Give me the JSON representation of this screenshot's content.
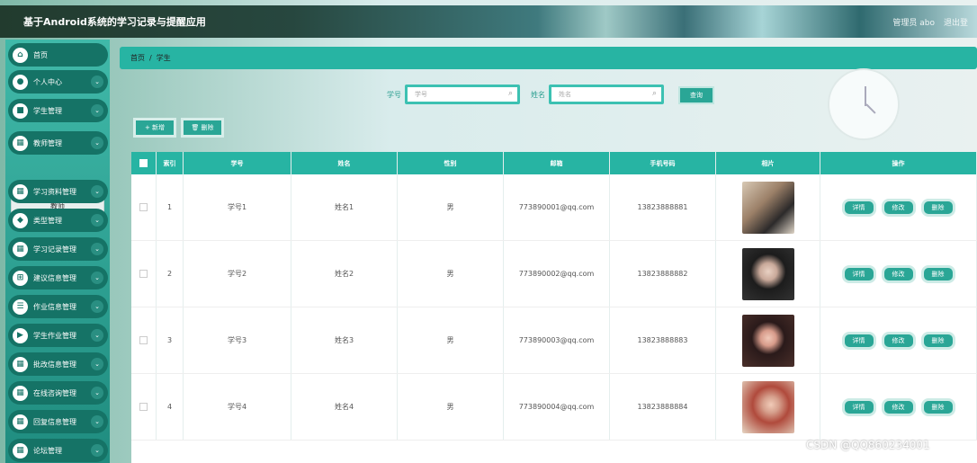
{
  "header": {
    "title": "基于Android系统的学习记录与提醒应用",
    "user": "管理员 abo",
    "logout": "退出登"
  },
  "sidebar": {
    "items": [
      {
        "label": "首页",
        "icon": "home-icon",
        "glyph": "⌂",
        "chev": false
      },
      {
        "label": "个人中心",
        "icon": "user-icon",
        "glyph": "●",
        "chev": true
      },
      {
        "label": "学生管理",
        "icon": "student-icon",
        "glyph": "■",
        "chev": true
      },
      {
        "label": "教师管理",
        "icon": "teacher-icon",
        "glyph": "▦",
        "chev": true
      },
      {
        "label": "学习资料管理",
        "icon": "material-icon",
        "glyph": "▦",
        "chev": true
      },
      {
        "label": "类型管理",
        "icon": "type-icon",
        "glyph": "◆",
        "chev": true
      },
      {
        "label": "学习记录管理",
        "icon": "record-icon",
        "glyph": "▦",
        "chev": true
      },
      {
        "label": "建议信息管理",
        "icon": "suggest-icon",
        "glyph": "⊞",
        "chev": true
      },
      {
        "label": "作业信息管理",
        "icon": "homework-icon",
        "glyph": "☰",
        "chev": true
      },
      {
        "label": "学生作业管理",
        "icon": "video-icon",
        "glyph": "▶",
        "chev": true
      },
      {
        "label": "批改信息管理",
        "icon": "correct-icon",
        "glyph": "▦",
        "chev": true
      },
      {
        "label": "在线咨询管理",
        "icon": "consult-icon",
        "glyph": "▦",
        "chev": true
      },
      {
        "label": "回复信息管理",
        "icon": "reply-icon",
        "glyph": "▦",
        "chev": true
      },
      {
        "label": "论坛管理",
        "icon": "forum-icon",
        "glyph": "▦",
        "chev": true
      }
    ],
    "sub_item": "教师"
  },
  "breadcrumb": {
    "home": "首页",
    "sep": "/",
    "current": "学生"
  },
  "search": {
    "label1": "学号",
    "placeholder1": "学号",
    "label2": "姓名",
    "placeholder2": "姓名",
    "query_btn": "查询"
  },
  "actions": {
    "add": "+ 新增",
    "delete": "🗑 删除"
  },
  "table": {
    "headers": [
      "",
      "索引",
      "学号",
      "姓名",
      "性别",
      "邮箱",
      "手机号码",
      "相片",
      "操作"
    ],
    "rows": [
      {
        "idx": "1",
        "no": "学号1",
        "name": "姓名1",
        "sex": "男",
        "email": "773890001@qq.com",
        "phone": "13823888881"
      },
      {
        "idx": "2",
        "no": "学号2",
        "name": "姓名2",
        "sex": "男",
        "email": "773890002@qq.com",
        "phone": "13823888882"
      },
      {
        "idx": "3",
        "no": "学号3",
        "name": "姓名3",
        "sex": "男",
        "email": "773890003@qq.com",
        "phone": "13823888883"
      },
      {
        "idx": "4",
        "no": "学号4",
        "name": "姓名4",
        "sex": "男",
        "email": "773890004@qq.com",
        "phone": "13823888884"
      }
    ],
    "row_buttons": {
      "detail": "详情",
      "edit": "修改",
      "del": "删除"
    }
  },
  "watermark": "CSDN @QQ860234001",
  "colors": {
    "accent": "#27b4a3",
    "sidebar_item": "#157366"
  }
}
